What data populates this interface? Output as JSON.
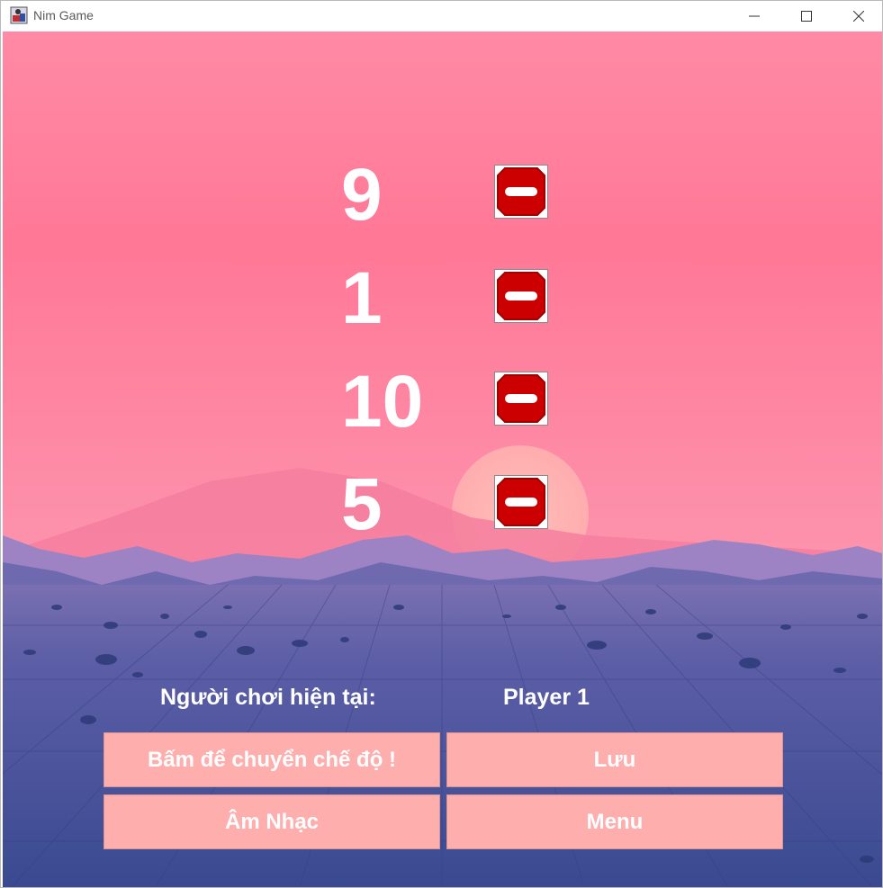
{
  "window": {
    "title": "Nim Game"
  },
  "piles": [
    {
      "count": "9",
      "remove_icon": "minus-circle-icon"
    },
    {
      "count": "1",
      "remove_icon": "minus-circle-icon"
    },
    {
      "count": "10",
      "remove_icon": "minus-circle-icon"
    },
    {
      "count": "5",
      "remove_icon": "minus-circle-icon"
    }
  ],
  "status": {
    "label": "Người chơi hiện tại:",
    "player": "Player 1"
  },
  "buttons": {
    "switch_mode": "Bấm để chuyển chế độ !",
    "save": "Lưu",
    "music": "Âm Nhạc",
    "menu": "Menu"
  },
  "colors": {
    "sky_top": "#ff8fab",
    "sky_mid": "#ff7597",
    "ground": "#3d4b92",
    "button_bg": "#ffaeae",
    "remove_red": "#cc0000"
  }
}
